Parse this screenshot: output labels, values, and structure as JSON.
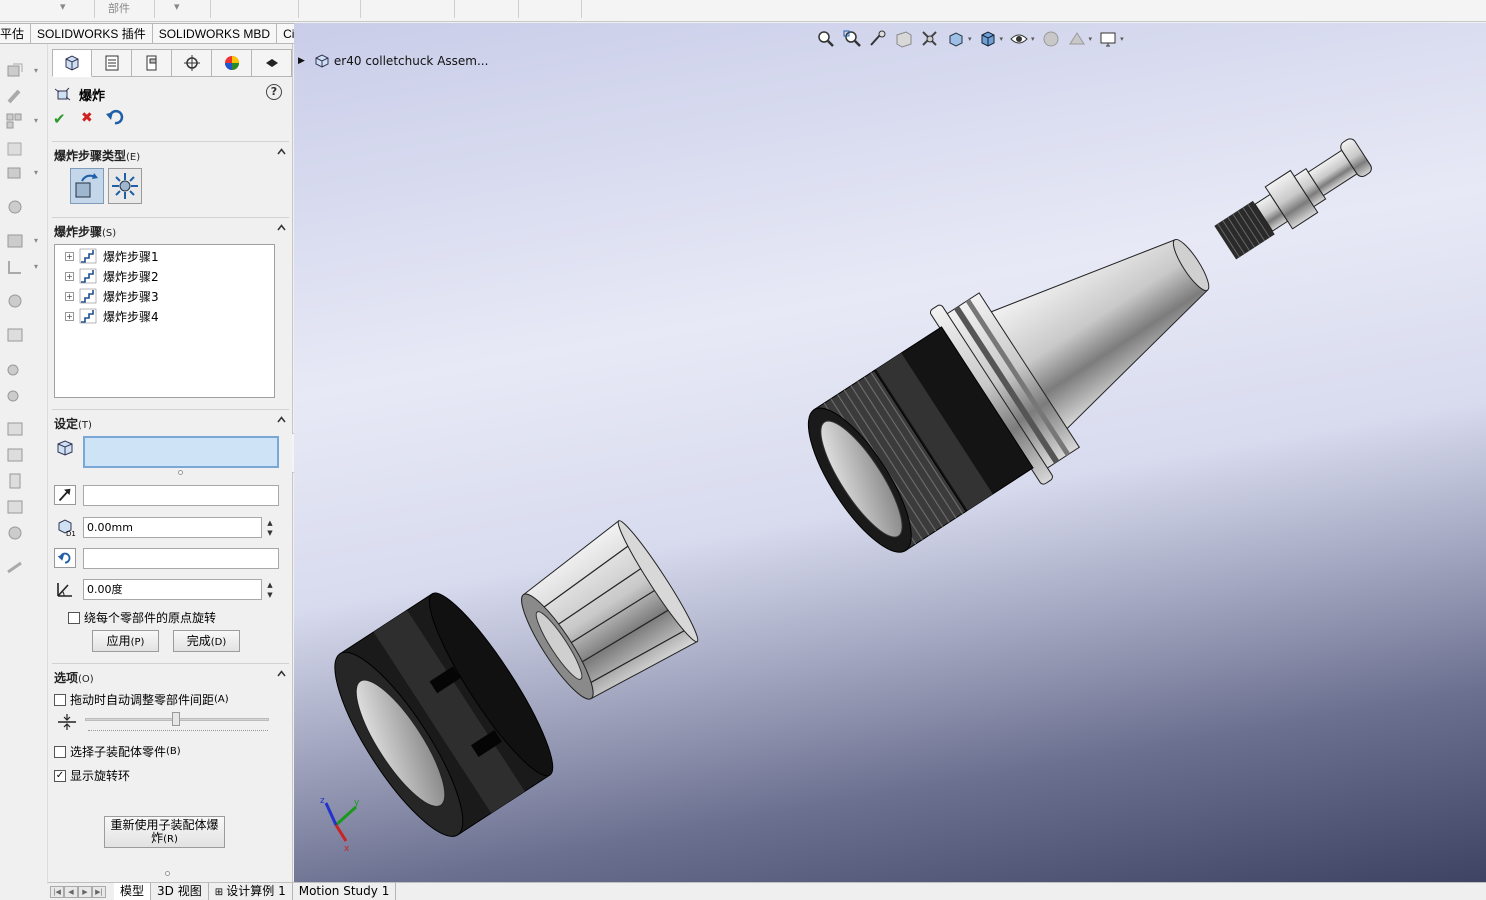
{
  "top_strip": {
    "faint_label": "部件"
  },
  "command_tabs": [
    "平估",
    "SOLIDWORKS 插件",
    "SOLIDWORKS MBD",
    "CircuitWorks"
  ],
  "panel": {
    "title": "爆炸",
    "help": "?",
    "group_type": {
      "title": "爆炸步骤类型",
      "shortcut": "(E)"
    },
    "group_steps": {
      "title": "爆炸步骤",
      "shortcut": "(S)"
    },
    "steps": [
      "爆炸步骤1",
      "爆炸步骤2",
      "爆炸步骤3",
      "爆炸步骤4"
    ],
    "group_settings": {
      "title": "设定",
      "shortcut": "(T)"
    },
    "components_field": "",
    "direction_field": "",
    "distance_value": "0.00mm",
    "rotation_axis_field": "",
    "angle_value": "0.00度",
    "rotate_about_origin_label": "绕每个零部件的原点旋转",
    "apply_label": "应用",
    "apply_shortcut": "(P)",
    "done_label": "完成",
    "done_shortcut": "(D)",
    "group_options": {
      "title": "选项",
      "shortcut": "(O)"
    },
    "auto_space_label": "拖动时自动调整零部件间距",
    "auto_space_shortcut": "(A)",
    "select_sub_parts_label": "选择子装配体零件",
    "select_sub_parts_shortcut": "(B)",
    "show_rotation_ring_label": "显示旋转环",
    "show_rotation_ring_checked": true,
    "reuse_btn_line1": "重新使用子装配体爆",
    "reuse_btn_line2": "炸",
    "reuse_btn_shortcut": "(R)"
  },
  "viewport": {
    "tree_root": "er40 colletchuck Assem...",
    "triad": {
      "x": "x",
      "y": "y",
      "z": "z"
    }
  },
  "bottom_tabs": [
    "模型",
    "3D 视图",
    "设计算例 1",
    "Motion Study 1"
  ],
  "active_bottom_tab": "模型",
  "colors": {
    "selection_field": "#cfe3f6",
    "ok_green": "#2a9a2a",
    "cancel_red": "#d02020"
  }
}
